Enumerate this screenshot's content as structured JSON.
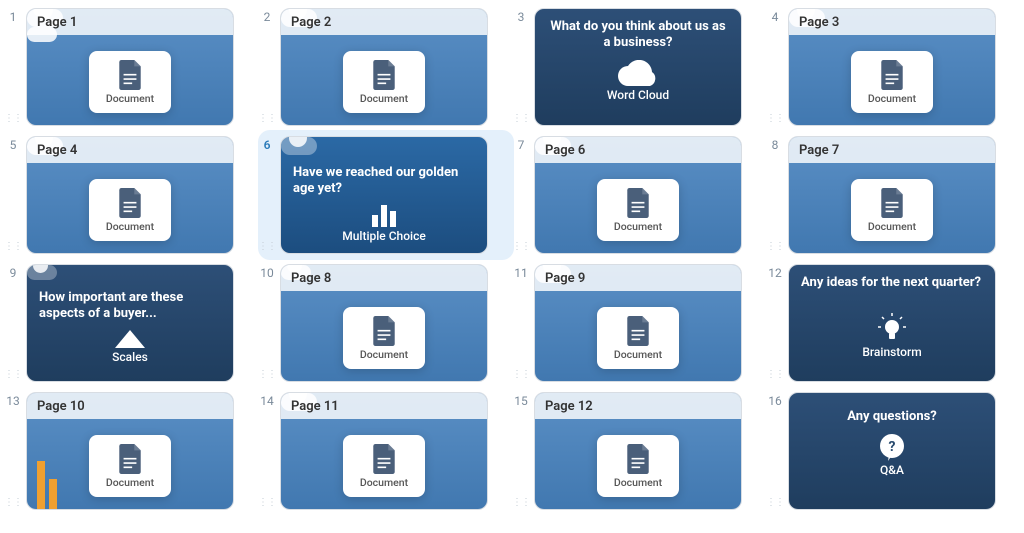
{
  "labels": {
    "document_badge": "Document"
  },
  "slides": [
    {
      "num": 1,
      "type": "doc",
      "title": "Page 1",
      "selected": false
    },
    {
      "num": 2,
      "type": "doc",
      "title": "Page 2",
      "selected": false
    },
    {
      "num": 3,
      "type": "activity",
      "question": "What do you think about us as a business?",
      "activity_label": "Word Cloud",
      "icon": "cloud",
      "selected": false
    },
    {
      "num": 4,
      "type": "doc",
      "title": "Page 3",
      "selected": false
    },
    {
      "num": 5,
      "type": "doc",
      "title": "Page 4",
      "selected": false
    },
    {
      "num": 6,
      "type": "activity",
      "question": "Have we reached our golden age yet?",
      "activity_label": "Multiple Choice",
      "icon": "bars",
      "selected": true
    },
    {
      "num": 7,
      "type": "doc",
      "title": "Page 6",
      "selected": false
    },
    {
      "num": 8,
      "type": "doc",
      "title": "Page 7",
      "selected": false
    },
    {
      "num": 9,
      "type": "activity",
      "question": "How important are these aspects of a buyer...",
      "activity_label": "Scales",
      "icon": "triangle",
      "selected": false
    },
    {
      "num": 10,
      "type": "doc",
      "title": "Page 8",
      "selected": false
    },
    {
      "num": 11,
      "type": "doc",
      "title": "Page 9",
      "selected": false
    },
    {
      "num": 12,
      "type": "activity",
      "question": "Any ideas for the next quarter?",
      "activity_label": "Brainstorm",
      "icon": "bulb",
      "selected": false
    },
    {
      "num": 13,
      "type": "doc",
      "title": "Page 10",
      "selected": false
    },
    {
      "num": 14,
      "type": "doc",
      "title": "Page 11",
      "selected": false
    },
    {
      "num": 15,
      "type": "doc",
      "title": "Page 12",
      "selected": false
    },
    {
      "num": 16,
      "type": "activity",
      "question": "Any questions?",
      "activity_label": "Q&A",
      "icon": "qa",
      "selected": false,
      "center_question": true
    }
  ]
}
